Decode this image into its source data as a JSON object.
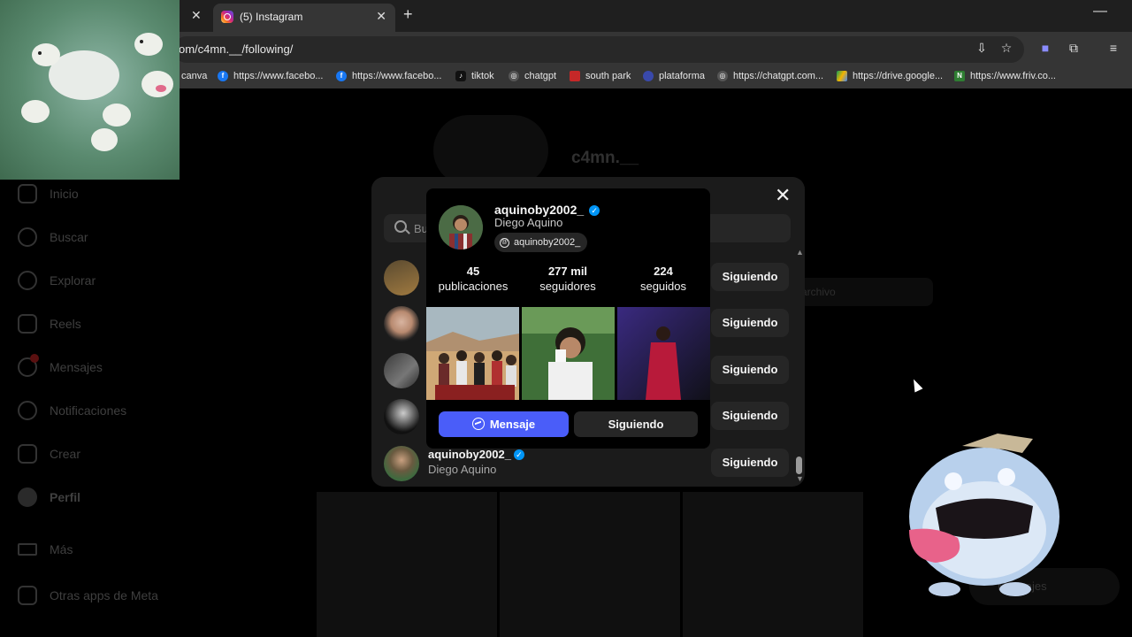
{
  "browser": {
    "tab_active_title": "(5) Instagram",
    "url": "om/c4mn.__/following/",
    "bookmarks": [
      {
        "label": "canva",
        "icon": "canva-icon"
      },
      {
        "label": "https://www.facebo...",
        "icon": "facebook-icon"
      },
      {
        "label": "https://www.facebo...",
        "icon": "facebook-icon"
      },
      {
        "label": "tiktok",
        "icon": "tiktok-icon"
      },
      {
        "label": "chatgpt",
        "icon": "chatgpt-icon"
      },
      {
        "label": "south park",
        "icon": "south-park-icon"
      },
      {
        "label": "plataforma",
        "icon": "plataforma-icon"
      },
      {
        "label": "https://chatgpt.com...",
        "icon": "chatgpt-icon"
      },
      {
        "label": "https://drive.google...",
        "icon": "google-drive-icon"
      },
      {
        "label": "https://www.friv.co...",
        "icon": "friv-icon"
      }
    ]
  },
  "sidebar": {
    "items": [
      {
        "label": "Inicio",
        "icon": "home-icon"
      },
      {
        "label": "Buscar",
        "icon": "search-icon"
      },
      {
        "label": "Explorar",
        "icon": "compass-icon"
      },
      {
        "label": "Reels",
        "icon": "reels-icon"
      },
      {
        "label": "Mensajes",
        "icon": "messenger-icon"
      },
      {
        "label": "Notificaciones",
        "icon": "heart-icon"
      },
      {
        "label": "Crear",
        "icon": "plus-icon"
      },
      {
        "label": "Perfil",
        "icon": "avatar-icon"
      },
      {
        "label": "Más",
        "icon": "menu-icon"
      },
      {
        "label": "Otras apps de Meta",
        "icon": "meta-apps-icon"
      }
    ]
  },
  "profile_bg": {
    "username": "c4mn.__",
    "archive_label": "archivo",
    "messages_label": "Mensajes"
  },
  "modal": {
    "search_placeholder": "Bu",
    "rows": [
      {
        "button": "Siguiendo"
      },
      {
        "button": "Siguiendo"
      },
      {
        "button": "Siguiendo"
      },
      {
        "button": "Siguiendo"
      },
      {
        "username": "aquinoby2002_",
        "fullname": "Diego Aquino",
        "verified": true,
        "button": "Siguiendo"
      }
    ]
  },
  "hovercard": {
    "username": "aquinoby2002_",
    "fullname": "Diego Aquino",
    "threads_handle": "aquinoby2002_",
    "stats": [
      {
        "num": "45",
        "label": "publicaciones"
      },
      {
        "num": "277 mil",
        "label": "seguidores"
      },
      {
        "num": "224",
        "label": "seguidos"
      }
    ],
    "message_button": "Mensaje",
    "follow_button": "Siguiendo"
  },
  "colors": {
    "accent_blue": "#4a5df9",
    "verified_blue": "#0095f6",
    "modal_bg": "#1b1b1b",
    "button_bg": "#262626"
  }
}
